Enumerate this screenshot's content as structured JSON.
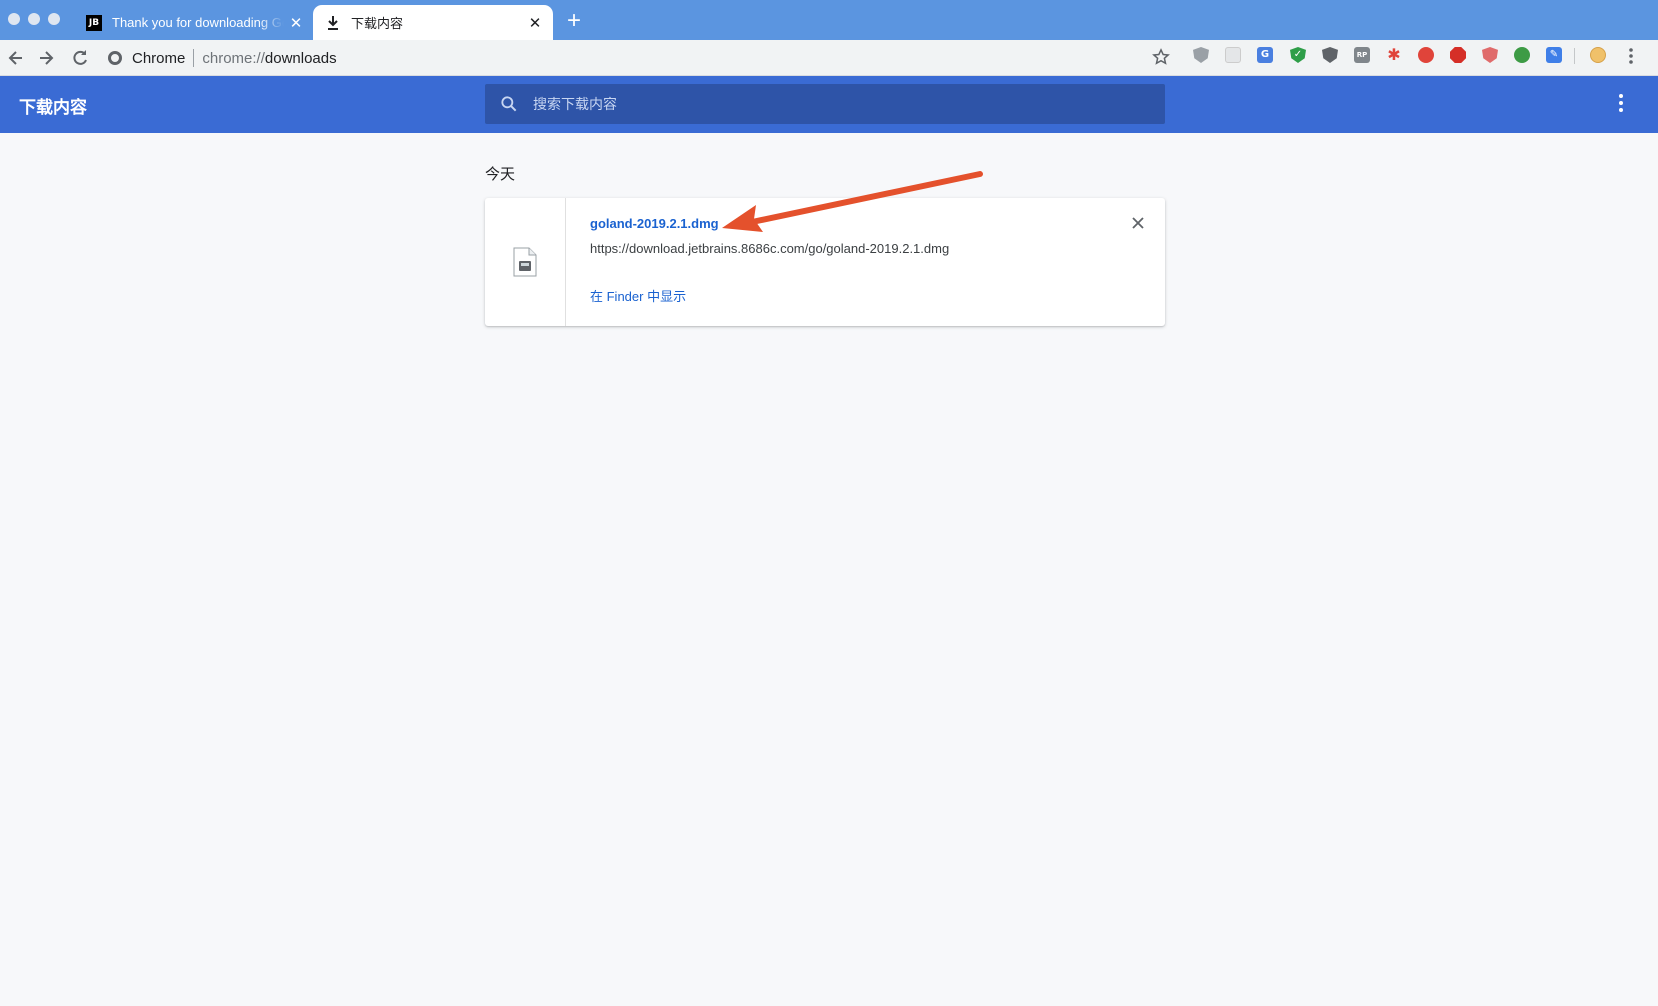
{
  "tabs": [
    {
      "title": "Thank you for downloading GoLand",
      "favicon": "jetbrains-logo",
      "favicon_text": "JB",
      "active": false
    },
    {
      "title": "下载内容",
      "favicon": "download-icon",
      "active": true
    }
  ],
  "toolbar": {
    "site_label": "Chrome",
    "url_scheme": "chrome://",
    "url_path": "downloads",
    "extensions": [
      "ghostery-shield-icon",
      "extension-shield-icon",
      "google-translate-icon",
      "adguard-shield-icon",
      "privacy-badger-icon",
      "rp-icon",
      "pinwheel-icon",
      "red-target-icon",
      "adblock-stop-icon",
      "red-shield-icon",
      "evernote-icon",
      "blue-pen-icon",
      "profile-avatar-icon"
    ]
  },
  "header": {
    "title": "下载内容",
    "search_placeholder": "搜索下载内容"
  },
  "downloads": {
    "day_label": "今天",
    "items": [
      {
        "file_name": "goland-2019.2.1.dmg",
        "url": "https://download.jetbrains.8686c.com/go/goland-2019.2.1.dmg",
        "action_label": "在 Finder 中显示"
      }
    ]
  },
  "colors": {
    "tabstrip": "#5b95e0",
    "header": "#3a6bd4",
    "search_bg": "#2e54a8",
    "link": "#1a62d0",
    "annotation_arrow": "#e4512c"
  }
}
